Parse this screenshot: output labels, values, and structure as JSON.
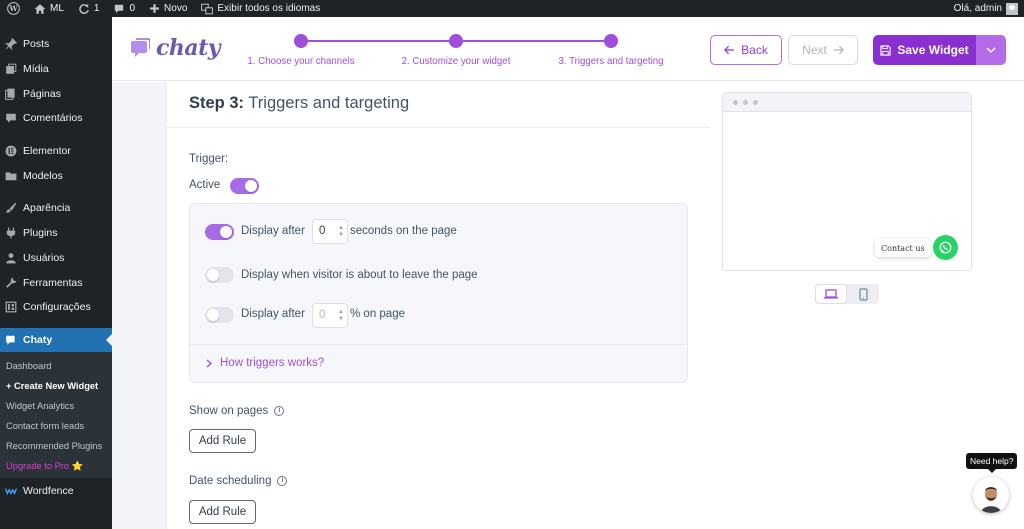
{
  "admin_bar": {
    "site_name": "ML",
    "updates_count": "1",
    "comments_count": "0",
    "new_label": "Novo",
    "languages_label": "Exibir todos os idiomas",
    "greeting": "Olá, admin"
  },
  "sidebar": {
    "items": [
      {
        "label": "Posts",
        "icon": "pin-icon"
      },
      {
        "label": "Mídia",
        "icon": "media-icon"
      },
      {
        "label": "Páginas",
        "icon": "page-icon"
      },
      {
        "label": "Comentários",
        "icon": "comment-icon"
      },
      {
        "label": "Elementor",
        "icon": "elementor-icon"
      },
      {
        "label": "Modelos",
        "icon": "folder-icon"
      },
      {
        "label": "Aparência",
        "icon": "brush-icon"
      },
      {
        "label": "Plugins",
        "icon": "plugin-icon"
      },
      {
        "label": "Usuários",
        "icon": "user-icon"
      },
      {
        "label": "Ferramentas",
        "icon": "wrench-icon"
      },
      {
        "label": "Configurações",
        "icon": "settings-icon"
      },
      {
        "label": "Chaty",
        "icon": "chat-icon"
      },
      {
        "label": "Wordfence",
        "icon": "wordfence-icon"
      }
    ],
    "submenu": [
      {
        "label": "Dashboard"
      },
      {
        "label": "+ Create New Widget"
      },
      {
        "label": "Widget Analytics"
      },
      {
        "label": "Contact form leads"
      },
      {
        "label": "Recommended Plugins"
      },
      {
        "label": "Upgrade to Pro ⭐"
      }
    ]
  },
  "chaty": {
    "logo": "chaty",
    "steps": [
      {
        "label": "1. Choose your channels"
      },
      {
        "label": "2. Customize your widget"
      },
      {
        "label": "3. Triggers and targeting"
      }
    ],
    "back_label": "Back",
    "next_label": "Next",
    "save_label": "Save Widget",
    "heading_bold": "Step 3:",
    "heading_rest": "Triggers and targeting",
    "trigger_label": "Trigger:",
    "active_label": "Active",
    "rows": {
      "after_seconds_prefix": "Display after",
      "after_seconds_value": "0",
      "after_seconds_suffix": "seconds on the page",
      "exit_intent": "Display when visitor is about to leave the page",
      "after_scroll_prefix": "Display after",
      "after_scroll_value": "0",
      "after_scroll_suffix": "% on page"
    },
    "how_link": "How triggers works?",
    "show_on_pages": "Show on pages",
    "add_rule_1": "Add Rule",
    "date_scheduling": "Date scheduling",
    "add_rule_2": "Add Rule"
  },
  "preview": {
    "contact_label": "Contact us"
  },
  "help": {
    "label": "Need help?"
  },
  "colors": {
    "accent": "#a04fd9",
    "save": "#8a2fd0",
    "whatsapp": "#25d366",
    "wp_current": "#2271b1"
  }
}
